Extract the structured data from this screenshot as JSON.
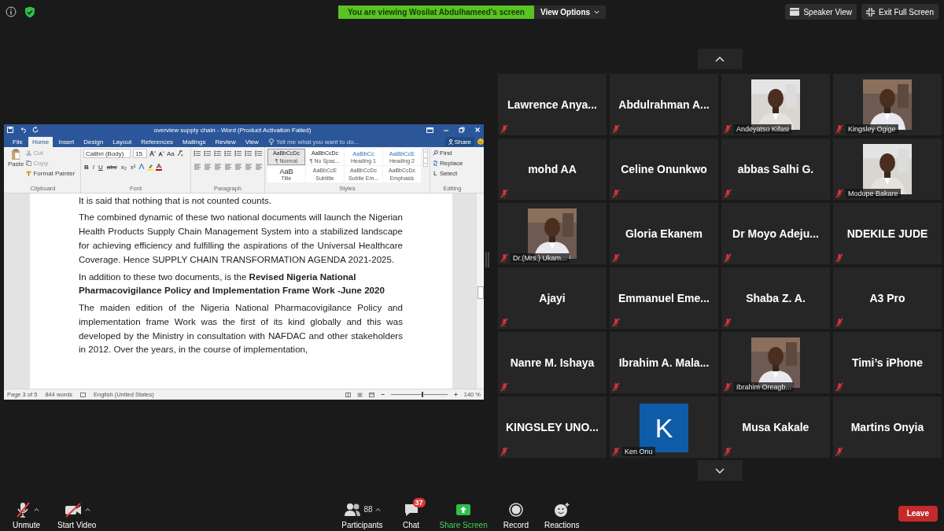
{
  "top_bar": {
    "banner": "You are viewing Wosilat Abdulhameed's screen",
    "view_options": "View Options",
    "speaker_view": "Speaker View",
    "exit_full_screen": "Exit Full Screen"
  },
  "word": {
    "title": "overview supply chain - Word (Product Activation Failed)",
    "tabs": [
      {
        "label": "File",
        "selected": false
      },
      {
        "label": "Home",
        "selected": true
      },
      {
        "label": "Insert",
        "selected": false
      },
      {
        "label": "Design",
        "selected": false
      },
      {
        "label": "Layout",
        "selected": false
      },
      {
        "label": "References",
        "selected": false
      },
      {
        "label": "Mailings",
        "selected": false
      },
      {
        "label": "Review",
        "selected": false
      },
      {
        "label": "View",
        "selected": false
      }
    ],
    "tell_me": "Tell me what you want to do...",
    "share": "Share",
    "clipboard": {
      "paste": "Paste",
      "items": [
        "Cut",
        "Copy",
        "Format Painter"
      ],
      "label": "Clipboard"
    },
    "font": {
      "family": "Calibri (Body)",
      "size": "15",
      "case_button": "Aa",
      "format_buttons": [
        "B",
        "I",
        "U",
        "abc",
        "x₂",
        "x²"
      ],
      "label": "Font"
    },
    "paragraph": {
      "label": "Paragraph"
    },
    "styles": {
      "label": "Styles",
      "items": [
        {
          "preview": "AaBbCcDc",
          "name": "¶ Normal",
          "kind": "normal",
          "selected": true
        },
        {
          "preview": "AaBbCcDc",
          "name": "¶ No Spac...",
          "kind": "normal",
          "selected": false
        },
        {
          "preview": "AaBbCc",
          "name": "Heading 1",
          "kind": "heading",
          "selected": false
        },
        {
          "preview": "AaBbCcE",
          "name": "Heading 2",
          "kind": "heading",
          "selected": false
        },
        {
          "preview": "AaB",
          "name": "Title",
          "kind": "title",
          "selected": false
        },
        {
          "preview": "AaBbCcE",
          "name": "Subtitle",
          "kind": "subtle",
          "selected": false
        },
        {
          "preview": "AaBbCcDc",
          "name": "Subtle Em...",
          "kind": "subtle",
          "selected": false
        },
        {
          "preview": "AaBbCcDc",
          "name": "Emphasis",
          "kind": "subtle",
          "selected": false
        }
      ]
    },
    "editing": {
      "items": [
        "Find",
        "Replace",
        "Select"
      ],
      "label": "Editing"
    },
    "paragraphs": [
      {
        "text": "It is said that nothing that is not counted counts.",
        "kind": "justified"
      },
      {
        "text": "The combined dynamic of these two national documents will launch the Nigerian Health Products Supply Chain Management System into a stabilized landscape for achieving efficiency and fulfilling the aspirations of the Universal Healthcare Coverage. Hence SUPPLY CHAIN TRANSFORMATION AGENDA 2021-2025.",
        "kind": "justified"
      },
      {
        "text": "In addition to these two documents, is the **Revised Nigeria National Pharmacovigilance Policy and Implementation Frame Work -June 2020**",
        "kind": "ragged"
      },
      {
        "text": "The maiden edition of the Nigeria National Pharmacovigilance Policy and implementation frame Work was the first of its kind globally and this was developed by the Ministry in consultation with NAFDAC and other stakeholders in 2012. Over the years, in the course of implementation,",
        "kind": "justified"
      }
    ],
    "status": {
      "page": "Page 3 of 5",
      "words": "844 words",
      "language": "English (United States)",
      "zoom": "140 %",
      "zoom_slider": {
        "level": 0.55
      }
    }
  },
  "gallery": {
    "participants": [
      {
        "name": "Lawrence Anya...",
        "kind": "name",
        "muted": true
      },
      {
        "name": "Abdulrahman A...",
        "kind": "name",
        "muted": true
      },
      {
        "name": "Andeyatso Kifasi",
        "kind": "video",
        "muted": true
      },
      {
        "name": "Kingsley Ogige",
        "kind": "video",
        "muted": true
      },
      {
        "name": "mohd AA",
        "kind": "name",
        "muted": true
      },
      {
        "name": "Celine Onunkwo",
        "kind": "name",
        "muted": true
      },
      {
        "name": "abbas Salhi G.",
        "kind": "name",
        "muted": true
      },
      {
        "name": "Modupe Bakare",
        "kind": "video",
        "muted": true
      },
      {
        "name": "Dr.(Mrs.) Ukam...",
        "kind": "video",
        "muted": true
      },
      {
        "name": "Gloria Ekanem",
        "kind": "name",
        "muted": true
      },
      {
        "name": "Dr Moyo Adeju...",
        "kind": "name",
        "muted": true
      },
      {
        "name": "NDEKILE JUDE",
        "kind": "name",
        "muted": true
      },
      {
        "name": "Ajayi",
        "kind": "name",
        "muted": true
      },
      {
        "name": "Emmanuel Eme...",
        "kind": "name",
        "muted": true
      },
      {
        "name": "Shaba Z. A.",
        "kind": "name",
        "muted": true
      },
      {
        "name": "A3 Pro",
        "kind": "name",
        "muted": true
      },
      {
        "name": "Nanre M. Ishaya",
        "kind": "name",
        "muted": true
      },
      {
        "name": "Ibrahim A. Mala...",
        "kind": "name",
        "muted": true
      },
      {
        "name": "Ibrahim Oreagb...",
        "kind": "video",
        "muted": true
      },
      {
        "name": "Timi’s iPhone",
        "kind": "name",
        "muted": true
      },
      {
        "name": "KINGSLEY UNO...",
        "kind": "name",
        "muted": true
      },
      {
        "name": "Ken Onu",
        "kind": "avatar",
        "initial": "K",
        "muted": true
      },
      {
        "name": "Musa Kakale",
        "kind": "name",
        "muted": true
      },
      {
        "name": "Martins Onyia",
        "kind": "name",
        "muted": true
      }
    ]
  },
  "toolbar": {
    "items": [
      {
        "label": "Unmute",
        "kind": "mic",
        "caret": true
      },
      {
        "label": "Start Video",
        "kind": "video",
        "caret": true
      },
      {
        "label": "Participants",
        "kind": "participants",
        "count": "88",
        "caret": true
      },
      {
        "label": "Chat",
        "kind": "chat",
        "badge": "37",
        "caret": false
      },
      {
        "label": "Share Screen",
        "kind": "share",
        "caret": false
      },
      {
        "label": "Record",
        "kind": "record",
        "caret": false
      },
      {
        "label": "Reactions",
        "kind": "reactions",
        "caret": false
      }
    ],
    "leave": "Leave"
  }
}
